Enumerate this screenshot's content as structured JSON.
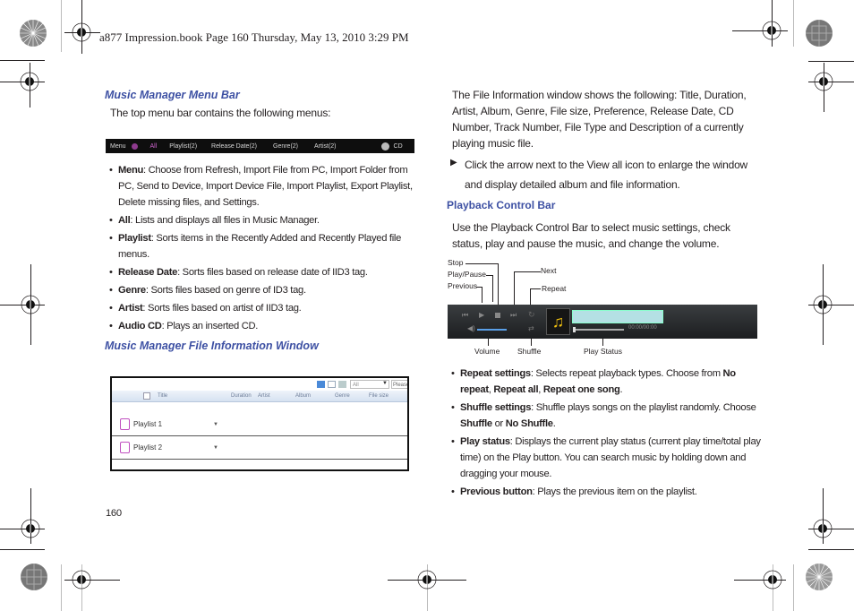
{
  "page_header": "a877 Impression.book  Page 160  Thursday, May 13, 2010  3:29 PM",
  "page_number": "160",
  "left": {
    "menu_bar_heading": "Music Manager Menu Bar",
    "menu_bar_intro": "The top menu bar contains the following menus:",
    "menu_bar_screenshot": {
      "items": [
        "Menu",
        "All",
        "Playlist(2)",
        "Release Date(2)",
        "Genre(2)",
        "Artist(2)",
        "CD"
      ]
    },
    "bullets": [
      {
        "term": "Menu",
        "text": ": Choose from Refresh, Import File from PC, Import Folder from PC, Send to Device, Import Device File, Import Playlist, Export Playlist, Delete missing files, and Settings."
      },
      {
        "term": "All",
        "text": ": Lists and displays all files in Music Manager."
      },
      {
        "term": "Playlist",
        "text": ": Sorts items in the Recently Added and Recently Played file menus."
      },
      {
        "term": "Release Date",
        "text": ": Sorts files based on release date of IID3 tag."
      },
      {
        "term": "Genre",
        "text": ": Sorts files based on genre of ID3 tag."
      },
      {
        "term": "Artist",
        "text": ": Sorts files based on artist of IID3 tag."
      },
      {
        "term": "Audio CD",
        "text": ": Plays an inserted CD."
      }
    ],
    "file_info_heading": "Music Manager File Information Window",
    "file_info_screenshot": {
      "filter_value": "All",
      "search_placeholder": "Please",
      "columns": [
        "Title",
        "Duration",
        "Artist",
        "Album",
        "Genre",
        "File size"
      ],
      "rows": [
        "Playlist 1",
        "Playlist 2"
      ]
    }
  },
  "right": {
    "file_info_text": "The File Information window shows the following: Title, Duration, Artist, Album, Genre, File size, Preference, Release Date, CD Number, Track Number, File Type and Description of a currently playing music file.",
    "arrow_step": "Click the arrow next to the View all icon to enlarge the window and display detailed album and file information.",
    "playback_heading": "Playback Control Bar",
    "playback_intro": "Use the Playback Control Bar to select music settings, check status, play and pause the music, and change the volume.",
    "playback_screenshot": {
      "time": "00:00/00:00",
      "callouts": {
        "stop": "Stop",
        "play_pause": "Play/Pause",
        "previous": "Previous",
        "next": "Next",
        "repeat": "Repeat",
        "volume": "Volume",
        "shuffle": "Shuffle",
        "play_status": "Play Status"
      }
    },
    "bullets": [
      {
        "parts": [
          [
            "b",
            "Repeat settings"
          ],
          [
            "t",
            ": Selects repeat playback types. Choose from "
          ],
          [
            "b",
            "No repeat"
          ],
          [
            "t",
            ", "
          ],
          [
            "b",
            "Repeat all"
          ],
          [
            "t",
            ", "
          ],
          [
            "b",
            "Repeat one song"
          ],
          [
            "t",
            "."
          ]
        ]
      },
      {
        "parts": [
          [
            "b",
            "Shuffle settings"
          ],
          [
            "t",
            ": Shuffle plays songs on the playlist randomly. Choose "
          ],
          [
            "b",
            "Shuffle"
          ],
          [
            "t",
            " or "
          ],
          [
            "b",
            "No Shuffle"
          ],
          [
            "t",
            "."
          ]
        ]
      },
      {
        "parts": [
          [
            "b",
            "Play status"
          ],
          [
            "t",
            ": Displays the current play status (current play time/total play time) on the Play button. You can search music by holding down and dragging your mouse."
          ]
        ]
      },
      {
        "parts": [
          [
            "b",
            "Previous button"
          ],
          [
            "t",
            ": Plays the previous item on the playlist."
          ]
        ]
      }
    ]
  }
}
